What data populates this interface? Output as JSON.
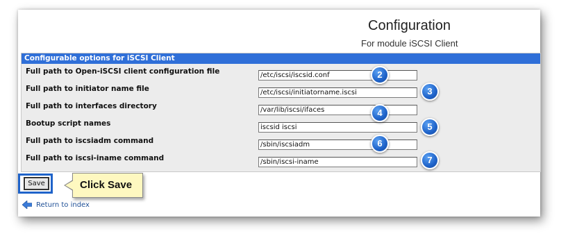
{
  "header": {
    "title": "Configuration",
    "subtitle": "For module iSCSI Client"
  },
  "panel": {
    "title": "Configurable options for iSCSI Client",
    "rows": [
      {
        "label": "Full path to Open-iSCSI client configuration file",
        "value": "/etc/iscsi/iscsid.conf",
        "badge": "2"
      },
      {
        "label": "Full path to initiator name file",
        "value": "/etc/iscsi/initiatorname.iscsi",
        "badge": "3"
      },
      {
        "label": "Full path to interfaces directory",
        "value": "/var/lib/iscsi/ifaces",
        "badge": "4"
      },
      {
        "label": "Bootup script names",
        "value": "iscsid iscsi",
        "badge": "5"
      },
      {
        "label": "Full path to iscsiadm command",
        "value": "/sbin/iscsiadm",
        "badge": "6"
      },
      {
        "label": "Full path to iscsi-iname command",
        "value": "/sbin/iscsi-iname",
        "badge": "7"
      }
    ]
  },
  "actions": {
    "save_label": "Save",
    "callout_text": "Click Save",
    "return_label": "Return to index"
  },
  "icons": {
    "badge": "step-number-badge",
    "return": "back-arrow-icon"
  },
  "colors": {
    "header_bar": "#2f6fd8",
    "badge": "#1f63c9",
    "callout_bg": "#fef8c0",
    "link": "#1e4f96"
  }
}
